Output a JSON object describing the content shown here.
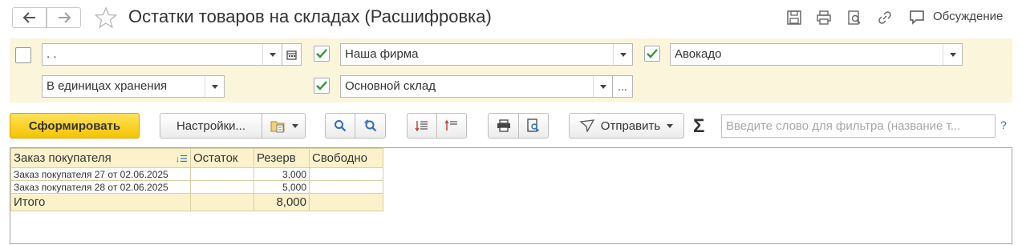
{
  "header": {
    "title": "Остатки товаров на складах (Расшифровка)",
    "discuss_label": "Обсуждение",
    "nav_back_icon": "arrow-left-icon",
    "nav_forward_icon": "arrow-right-icon"
  },
  "filters": {
    "period_value": ". .",
    "organization_value": "Наша фирма",
    "nomenclature_value": "Авокадо",
    "units_value": "В единицах хранения",
    "warehouse_value": "Основной склад",
    "more_label": "..."
  },
  "toolbar": {
    "generate_label": "Сформировать",
    "settings_label": "Настройки...",
    "send_label": "Отправить",
    "sigma_label": "Σ",
    "search_placeholder": "Введите слово для фильтра (название т...",
    "help_label": "?"
  },
  "table": {
    "columns": [
      "Заказ покупателя",
      "Остаток",
      "Резерв",
      "Свободно"
    ],
    "rows": [
      {
        "order": "Заказ покупателя 27 от 02.06.2025",
        "balance": "",
        "reserve": "3,000",
        "free": ""
      },
      {
        "order": "Заказ покупателя 28 от 02.06.2025",
        "balance": "",
        "reserve": "5,000",
        "free": ""
      }
    ],
    "total": {
      "label": "Итого",
      "balance": "",
      "reserve": "8,000",
      "free": ""
    }
  },
  "colors": {
    "accent_yellow": "#f5c400",
    "panel_bg": "#fbf5dc",
    "check_green": "#2e9a3a",
    "link_blue": "#2f6bc4"
  }
}
